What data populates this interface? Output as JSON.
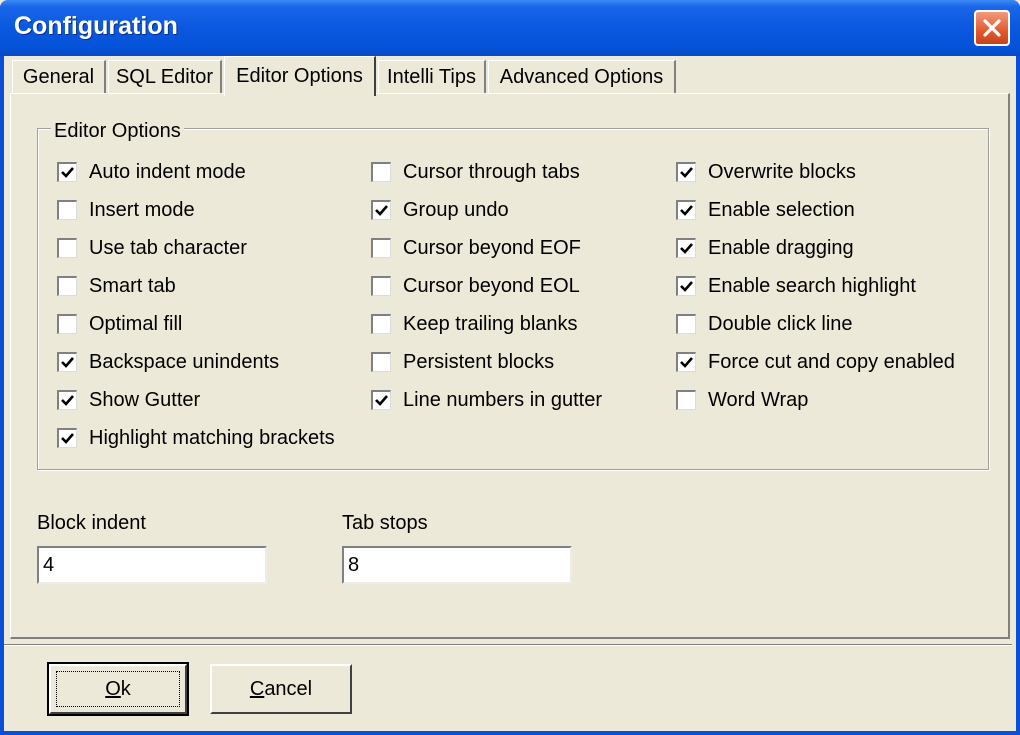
{
  "window": {
    "title": "Configuration"
  },
  "tabs": [
    "General",
    "SQL Editor",
    "Editor Options",
    "Intelli Tips",
    "Advanced Options"
  ],
  "active_tab": "Editor Options",
  "group": {
    "title": "Editor Options",
    "columns": [
      [
        {
          "label": "Auto indent mode",
          "checked": true
        },
        {
          "label": "Insert mode",
          "checked": false
        },
        {
          "label": "Use tab character",
          "checked": false
        },
        {
          "label": "Smart tab",
          "checked": false
        },
        {
          "label": "Optimal fill",
          "checked": false
        },
        {
          "label": "Backspace unindents",
          "checked": true
        },
        {
          "label": "Show Gutter",
          "checked": true
        },
        {
          "label": "Highlight matching brackets",
          "checked": true
        }
      ],
      [
        {
          "label": "Cursor through tabs",
          "checked": false
        },
        {
          "label": "Group undo",
          "checked": true
        },
        {
          "label": "Cursor beyond EOF",
          "checked": false
        },
        {
          "label": "Cursor beyond EOL",
          "checked": false
        },
        {
          "label": "Keep trailing blanks",
          "checked": false
        },
        {
          "label": "Persistent blocks",
          "checked": false
        },
        {
          "label": "Line numbers in gutter",
          "checked": true
        }
      ],
      [
        {
          "label": "Overwrite blocks",
          "checked": true
        },
        {
          "label": "Enable selection",
          "checked": true
        },
        {
          "label": "Enable dragging",
          "checked": true
        },
        {
          "label": "Enable search highlight",
          "checked": true
        },
        {
          "label": "Double click line",
          "checked": false
        },
        {
          "label": "Force cut and copy enabled",
          "checked": true
        },
        {
          "label": "Word Wrap",
          "checked": false
        }
      ]
    ]
  },
  "fields": {
    "block_indent": {
      "label": "Block indent",
      "value": "4"
    },
    "tab_stops": {
      "label": "Tab stops",
      "value": "8"
    }
  },
  "buttons": {
    "ok": {
      "mnemonic": "O",
      "rest": "k"
    },
    "cancel": {
      "mnemonic": "C",
      "rest": "ancel"
    }
  }
}
